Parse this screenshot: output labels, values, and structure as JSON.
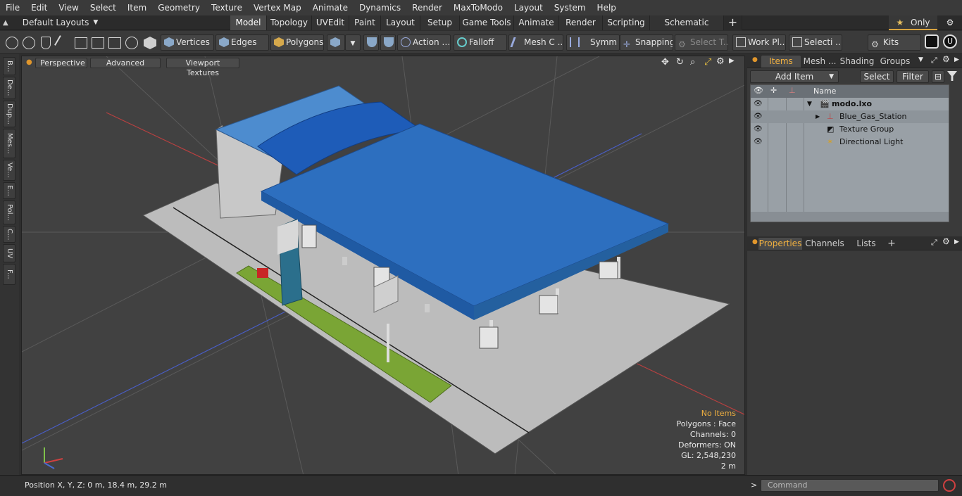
{
  "menu": [
    "File",
    "Edit",
    "View",
    "Select",
    "Item",
    "Geometry",
    "Texture",
    "Vertex Map",
    "Animate",
    "Dynamics",
    "Render",
    "MaxToModo",
    "Layout",
    "System",
    "Help"
  ],
  "layout_selector": "Default Layouts",
  "tabs": [
    {
      "label": "Model",
      "active": true
    },
    {
      "label": "Topology",
      "active": false
    },
    {
      "label": "UVEdit",
      "active": false
    },
    {
      "label": "Paint",
      "active": false
    },
    {
      "label": "Layout",
      "active": false
    },
    {
      "label": "Setup",
      "active": false
    },
    {
      "label": "Game Tools",
      "active": false
    },
    {
      "label": "Animate",
      "active": false
    },
    {
      "label": "Render",
      "active": false
    },
    {
      "label": "Scripting",
      "active": false
    },
    {
      "label": "Schematic Fusion",
      "active": false
    }
  ],
  "only_label": "Only",
  "toolbar": {
    "vertices": "Vertices",
    "edges": "Edges",
    "polygons": "Polygons",
    "action": "Action",
    "falloff": "Falloff",
    "mesh": "Mesh C ...",
    "symm": "Symm ...",
    "snapping": "Snapping",
    "select_t": "Select T...",
    "work_pl": "Work Pl...",
    "selecti": "Selecti ...",
    "kits": "Kits"
  },
  "left_tabs": [
    "B...",
    "De...",
    "Dup...",
    "Mes...",
    "Ve...",
    "E...",
    "Pol...",
    "C...",
    "UV",
    "F..."
  ],
  "viewport": {
    "perspective": "Perspective",
    "advanced": "Advanced",
    "textures": "Viewport Textures",
    "stats": {
      "no_items": "No Items",
      "polygons": "Polygons : Face",
      "channels": "Channels: 0",
      "deformers": "Deformers: ON",
      "gl": "GL: 2,548,230",
      "scale": "2 m"
    }
  },
  "status": {
    "position": "Position X, Y, Z:  0 m, 18.4 m, 29.2 m"
  },
  "items_panel": {
    "tabs": [
      "Items",
      "Mesh ...",
      "Shading",
      "Groups"
    ],
    "add_item": "Add Item",
    "select": "Select",
    "filter": "Filter",
    "name_header": "Name",
    "tree": [
      {
        "label": "modo.lxo",
        "bold": true
      },
      {
        "label": "Blue_Gas_Station",
        "bold": false
      },
      {
        "label": "Texture Group",
        "bold": false
      },
      {
        "label": "Directional Light",
        "bold": false
      }
    ]
  },
  "props_panel": {
    "tabs": [
      "Properties",
      "Channels",
      "Lists"
    ]
  },
  "command": {
    "placeholder": "Command"
  }
}
